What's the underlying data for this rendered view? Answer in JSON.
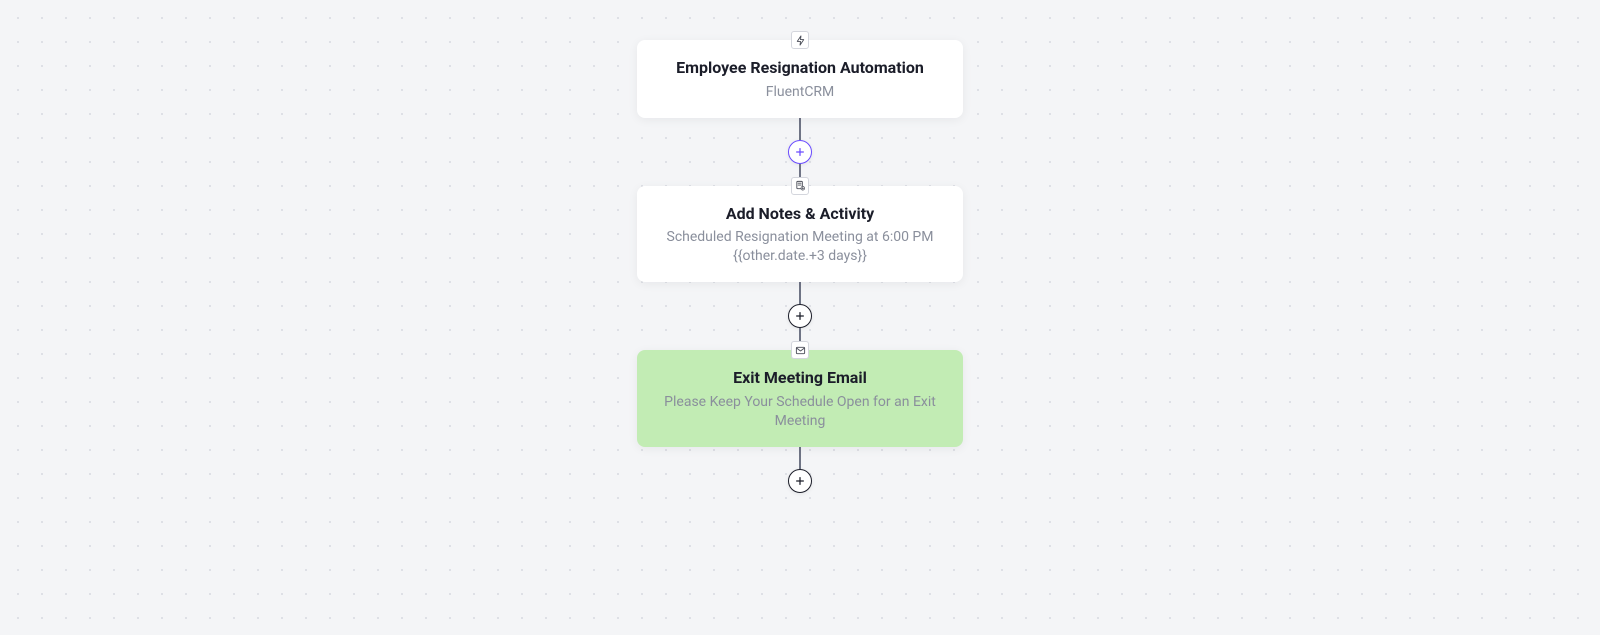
{
  "flow": {
    "nodes": [
      {
        "id": "trigger",
        "icon": "bolt",
        "title": "Employee Resignation Automation",
        "subtitle": "FluentCRM",
        "style": "white"
      },
      {
        "id": "add-notes",
        "icon": "notes",
        "title": "Add Notes & Activity",
        "subtitle": "Scheduled Resignation Meeting at 6:00 PM\n{{other.date.+3 days}}",
        "style": "white"
      },
      {
        "id": "exit-email",
        "icon": "email",
        "title": "Exit Meeting Email",
        "subtitle": "Please Keep Your Schedule Open for an Exit\nMeeting",
        "style": "green"
      }
    ],
    "connectors": [
      {
        "after_node": "trigger",
        "button_style": "accent"
      },
      {
        "after_node": "add-notes",
        "button_style": "default"
      },
      {
        "after_node": "exit-email",
        "button_style": "default"
      }
    ]
  },
  "colors": {
    "accent": "#6a4bff",
    "green_node": "#c2ecb4",
    "text_primary": "#1b1d29",
    "text_secondary": "#8a8f9c",
    "canvas_bg": "#f4f5f7"
  }
}
